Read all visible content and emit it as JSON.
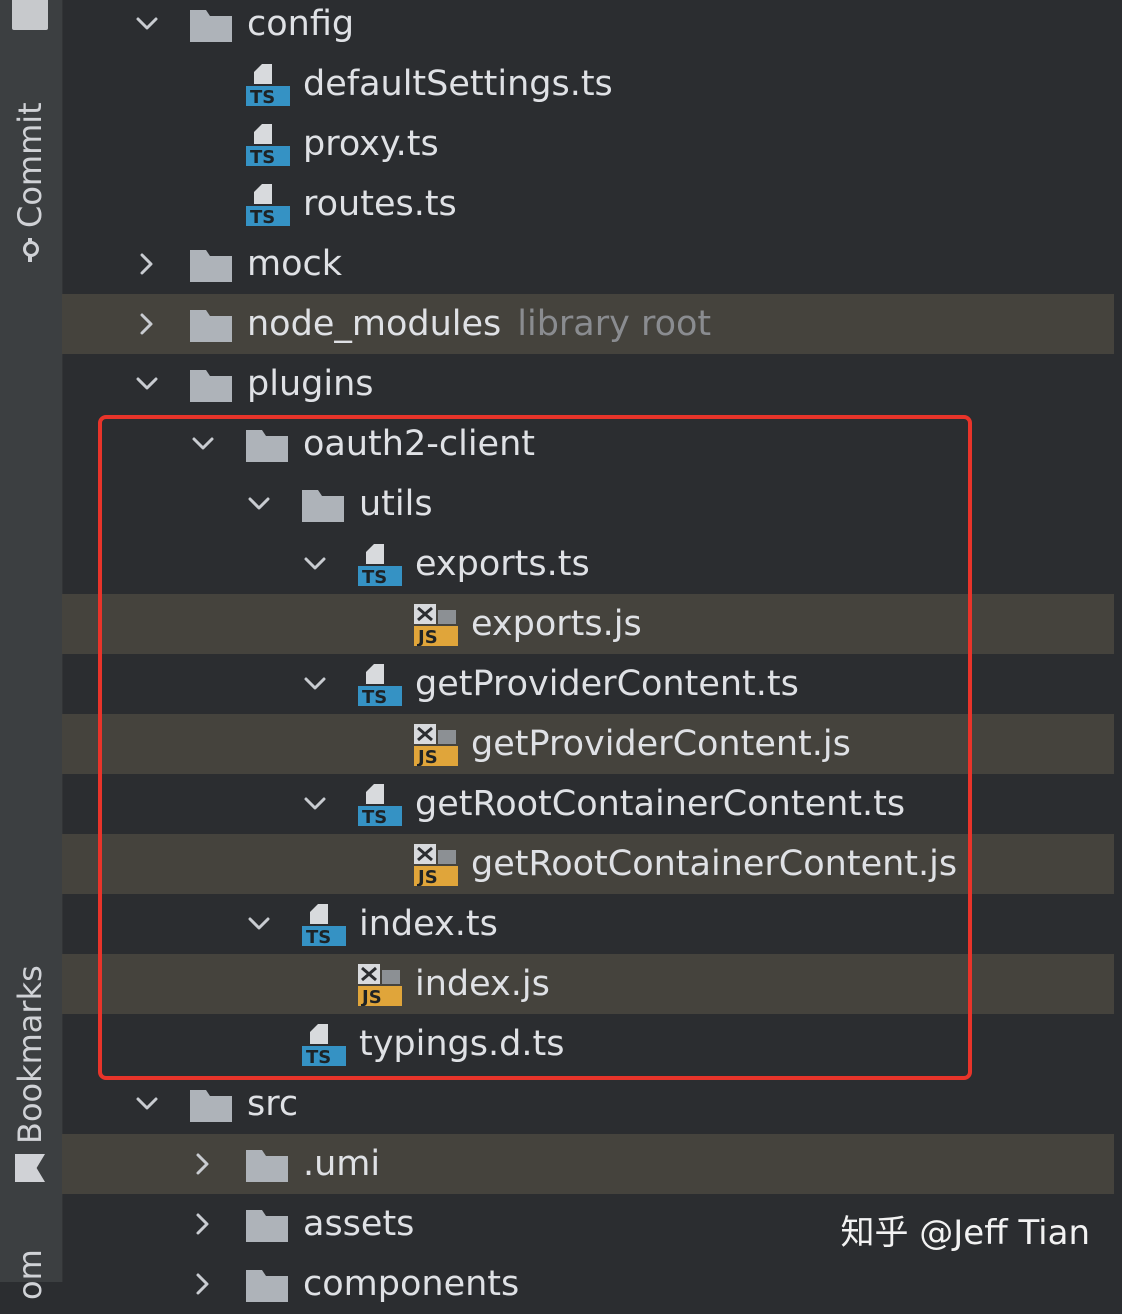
{
  "sidebar": {
    "tabs": [
      {
        "label": "Commit",
        "icon": "commit-icon"
      },
      {
        "label": "Bookmarks",
        "icon": "bookmark-icon"
      },
      {
        "label": "om",
        "icon": ""
      }
    ]
  },
  "tree": [
    {
      "label": "config",
      "type": "folder",
      "level": 0,
      "expanded": true,
      "highlight": false
    },
    {
      "label": "defaultSettings.ts",
      "type": "ts",
      "level": 1,
      "highlight": false
    },
    {
      "label": "proxy.ts",
      "type": "ts",
      "level": 1,
      "highlight": false
    },
    {
      "label": "routes.ts",
      "type": "ts",
      "level": 1,
      "highlight": false
    },
    {
      "label": "mock",
      "type": "folder",
      "level": 0,
      "expanded": false,
      "highlight": false
    },
    {
      "label": "node_modules",
      "hint": "library root",
      "type": "folder",
      "level": 0,
      "expanded": false,
      "highlight": true,
      "library": true
    },
    {
      "label": "plugins",
      "type": "folder",
      "level": 0,
      "expanded": true,
      "highlight": false
    },
    {
      "label": "oauth2-client",
      "type": "folder",
      "level": 1,
      "expanded": true,
      "highlight": false
    },
    {
      "label": "utils",
      "type": "folder",
      "level": 2,
      "expanded": true,
      "highlight": false
    },
    {
      "label": "exports.ts",
      "type": "ts",
      "level": 3,
      "expanded": true,
      "highlight": false
    },
    {
      "label": "exports.js",
      "type": "js",
      "level": 4,
      "highlight": true
    },
    {
      "label": "getProviderContent.ts",
      "type": "ts",
      "level": 3,
      "expanded": true,
      "highlight": false
    },
    {
      "label": "getProviderContent.js",
      "type": "js",
      "level": 4,
      "highlight": true
    },
    {
      "label": "getRootContainerContent.ts",
      "type": "ts",
      "level": 3,
      "expanded": true,
      "highlight": false
    },
    {
      "label": "getRootContainerContent.js",
      "type": "js",
      "level": 4,
      "highlight": true
    },
    {
      "label": "index.ts",
      "type": "ts",
      "level": 2,
      "expanded": true,
      "highlight": false
    },
    {
      "label": "index.js",
      "type": "js",
      "level": 3,
      "highlight": true
    },
    {
      "label": "typings.d.ts",
      "type": "ts",
      "level": 2,
      "highlight": false
    },
    {
      "label": "src",
      "type": "folder",
      "level": 0,
      "expanded": true,
      "highlight": false
    },
    {
      "label": ".umi",
      "type": "folder",
      "level": 1,
      "expanded": false,
      "highlight": true,
      "library": true
    },
    {
      "label": "assets",
      "type": "folder",
      "level": 1,
      "expanded": false,
      "highlight": false
    },
    {
      "label": "components",
      "type": "folder",
      "level": 1,
      "expanded": false,
      "highlight": false
    }
  ],
  "icons": {
    "ts_badge": "TS",
    "js_badge": "JS"
  },
  "colors": {
    "ts": "#3592c4",
    "js": "#e0a53a",
    "folder": "#aeb3b9",
    "highlight": "#45433d",
    "library": "#b3b33a",
    "selection_box": "#e8342a"
  },
  "watermark": "知乎 @Jeff Tian"
}
